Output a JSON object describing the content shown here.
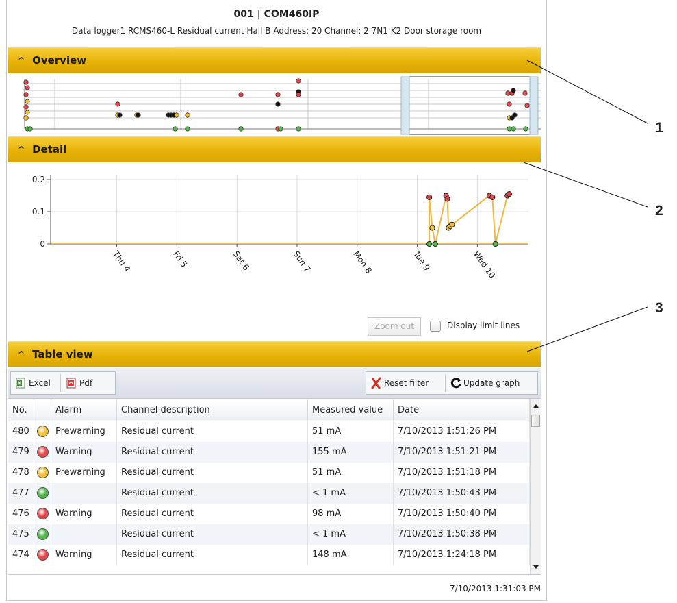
{
  "header": {
    "title": "001 | COM460IP",
    "subtitle": "Data logger1  RCMS460-L Residual current Hall B  Address: 20  Channel: 2  7N1 K2 Door storage room"
  },
  "sections": {
    "overview": "Overview",
    "detail": "Detail",
    "table": "Table view",
    "caret": "^"
  },
  "detail_controls": {
    "zoom_out": "Zoom out",
    "limit_lines": "Display limit lines"
  },
  "toolbar": {
    "excel": "Excel",
    "pdf": "Pdf",
    "reset_filter": "Reset filter",
    "update_graph": "Update graph"
  },
  "table": {
    "columns": [
      "No.",
      "",
      "Alarm",
      "Channel description",
      "Measured value",
      "Date"
    ],
    "rows": [
      {
        "no": "480",
        "status": "prewarning",
        "alarm": "Prewarning",
        "desc": "Residual current",
        "value": "51 mA",
        "date": "7/10/2013 1:51:26 PM"
      },
      {
        "no": "479",
        "status": "warning",
        "alarm": "Warning",
        "desc": "Residual current",
        "value": "155 mA",
        "date": "7/10/2013 1:51:21 PM"
      },
      {
        "no": "478",
        "status": "prewarning",
        "alarm": "Prewarning",
        "desc": "Residual current",
        "value": "51 mA",
        "date": "7/10/2013 1:51:18 PM"
      },
      {
        "no": "477",
        "status": "ok",
        "alarm": "",
        "desc": "Residual current",
        "value": "< 1 mA",
        "date": "7/10/2013 1:50:43 PM"
      },
      {
        "no": "476",
        "status": "warning",
        "alarm": "Warning",
        "desc": "Residual current",
        "value": "98 mA",
        "date": "7/10/2013 1:50:40 PM"
      },
      {
        "no": "475",
        "status": "ok",
        "alarm": "",
        "desc": "Residual current",
        "value": "< 1 mA",
        "date": "7/10/2013 1:50:38 PM"
      },
      {
        "no": "474",
        "status": "warning",
        "alarm": "Warning",
        "desc": "Residual current",
        "value": "148 mA",
        "date": "7/10/2013 1:24:18 PM"
      }
    ]
  },
  "status_colors": {
    "prewarning": "#f2c037",
    "warning": "#e8474b",
    "ok": "#4fb648"
  },
  "footer_timestamp": "7/10/2013 1:31:03 PM",
  "callouts": [
    "1",
    "2",
    "3"
  ],
  "chart_data": {
    "type": "line",
    "title": "",
    "xlabel": "",
    "ylabel": "",
    "ylim": [
      0,
      0.2
    ],
    "yticks": [
      "0",
      "0.1",
      "0.2"
    ],
    "xticks": [
      "Thu 4",
      "Fri 5",
      "Sat 6",
      "Sun 7",
      "Mon 8",
      "Tue 9",
      "Wed 10"
    ],
    "grid": true,
    "series": [
      {
        "x": [
          9.2,
          9.2,
          9.25,
          9.3,
          9.48,
          9.5,
          9.52,
          9.55,
          9.58,
          10.2,
          10.25,
          10.3,
          10.5,
          10.53
        ],
        "values": [
          0.0,
          0.145,
          0.05,
          0.0,
          0.15,
          0.14,
          0.05,
          0.055,
          0.06,
          0.15,
          0.145,
          0.0,
          0.15,
          0.155
        ]
      }
    ]
  }
}
